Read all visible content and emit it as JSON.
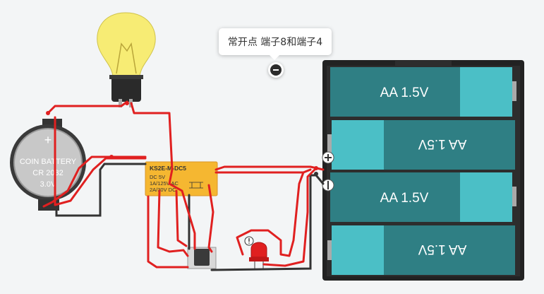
{
  "tooltip": {
    "text": "常开点 端子8和端子4"
  },
  "coin_battery": {
    "line1": "COIN BATTERY",
    "line2": "CR 2032",
    "line3": "3.0V"
  },
  "relay": {
    "title": "KS2E-M-DC5",
    "specs": [
      "DC 5V",
      "1A/125V AC",
      "2A/30V  DC"
    ]
  },
  "battery_pack": {
    "cells": [
      "AA 1.5V",
      "AA 1.5V",
      "AA 1.5V",
      "AA 1.5V"
    ]
  },
  "icons": {
    "remove": "minus-circle-icon",
    "led_warning": "info-warning-icon",
    "battery_plus": "plus-terminal-icon",
    "battery_minus": "minus-terminal-icon"
  },
  "colors": {
    "wire_red": "#e02020",
    "wire_dark": "#333333",
    "relay_body": "#f5b731",
    "battery_teal": "#2f7f84",
    "battery_light": "#4bbfc6",
    "bulb_glass": "#f7ec74"
  }
}
